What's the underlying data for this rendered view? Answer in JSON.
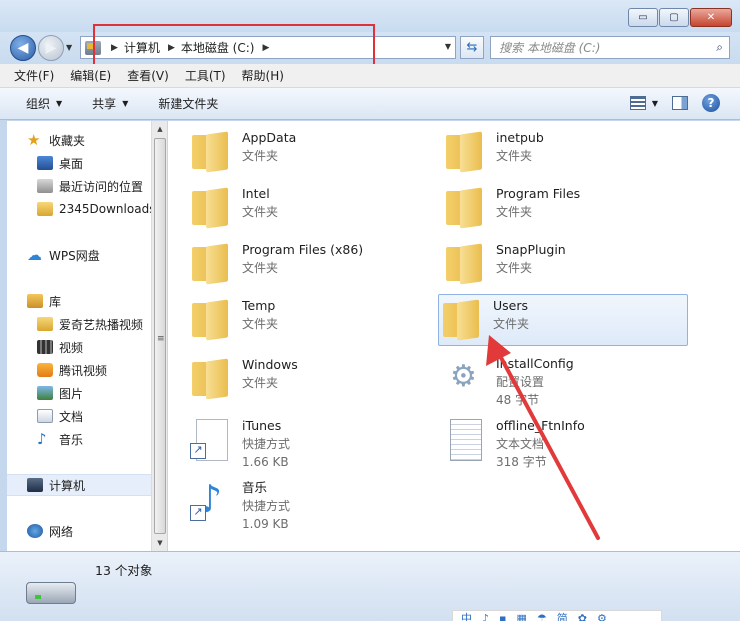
{
  "window": {
    "minimize": "▭",
    "maximize": "▢",
    "close": "✕"
  },
  "address": {
    "crumbs": [
      "计算机",
      "本地磁盘 (C:)"
    ],
    "search_placeholder": "搜索 本地磁盘 (C:)"
  },
  "menu": [
    "文件(F)",
    "编辑(E)",
    "查看(V)",
    "工具(T)",
    "帮助(H)"
  ],
  "toolbar": {
    "organize": "组织",
    "share": "共享",
    "new_folder": "新建文件夹",
    "help": "?"
  },
  "nav": {
    "favorites": "收藏夹",
    "desktop": "桌面",
    "recent": "最近访问的位置",
    "downloads": "2345Downloads",
    "wps": "WPS网盘",
    "library": "库",
    "iqiyi": "爱奇艺热播视频",
    "video": "视频",
    "tencent": "腾讯视频",
    "pictures": "图片",
    "documents": "文档",
    "music": "音乐",
    "computer": "计算机",
    "network": "网络"
  },
  "files": [
    {
      "name": "AppData",
      "type": "文件夹"
    },
    {
      "name": "inetpub",
      "type": "文件夹"
    },
    {
      "name": "Intel",
      "type": "文件夹"
    },
    {
      "name": "Program Files",
      "type": "文件夹"
    },
    {
      "name": "Program Files (x86)",
      "type": "文件夹"
    },
    {
      "name": "SnapPlugin",
      "type": "文件夹"
    },
    {
      "name": "Temp",
      "type": "文件夹"
    },
    {
      "name": "Users",
      "type": "文件夹"
    },
    {
      "name": "Windows",
      "type": "文件夹"
    },
    {
      "name": "InstallConfig",
      "type": "配置设置",
      "size": "48 字节"
    },
    {
      "name": "iTunes",
      "type": "快捷方式",
      "size": "1.66 KB"
    },
    {
      "name": "offline_FtnInfo",
      "type": "文本文档",
      "size": "318 字节"
    },
    {
      "name": "音乐",
      "type": "快捷方式",
      "size": "1.09 KB"
    }
  ],
  "status": {
    "count": "13 个对象"
  },
  "ime": [
    "中",
    "♪",
    "▪",
    "▦",
    "☂",
    "简",
    "✿",
    "⚙"
  ]
}
